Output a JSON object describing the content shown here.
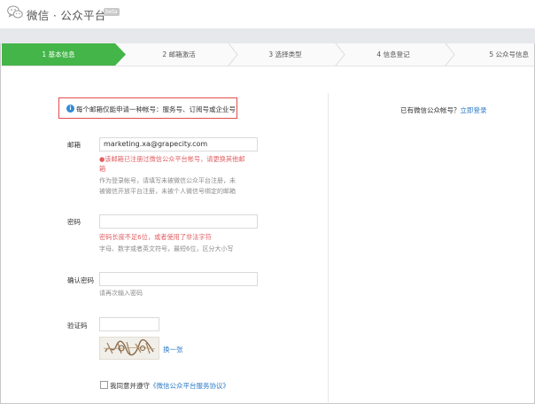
{
  "header": {
    "brand": "微信 · 公众平台",
    "badge": "beta"
  },
  "steps": [
    {
      "label": "1 基本信息",
      "active": true
    },
    {
      "label": "2 邮箱激活",
      "active": false
    },
    {
      "label": "3 选择类型",
      "active": false
    },
    {
      "label": "4 信息登记",
      "active": false
    },
    {
      "label": "5 公众号信息",
      "active": false
    }
  ],
  "notice": {
    "icon": "info-icon",
    "text": "每个邮箱仅能申请一种帐号：服务号、订阅号或企业号"
  },
  "form": {
    "email": {
      "label": "邮箱",
      "value": "marketing.xa@grapecity.com",
      "error_line1": "●该邮箱已注册过微信公众平台帐号，请更换其他邮",
      "error_line2": "箱",
      "tip_line1": "作为登录帐号，请填写未被微信公众平台注册，未",
      "tip_line2": "被微信开放平台注册，未被个人微信号绑定的邮箱"
    },
    "password": {
      "label": "密码",
      "value": "",
      "error": "密码长度不足6位，或者使用了非法字符",
      "tip": "字母、数字或者英文符号，最短6位，区分大小写"
    },
    "confirm_password": {
      "label": "确认密码",
      "value": "",
      "tip": "请再次输入密码"
    },
    "captcha": {
      "label": "验证码",
      "value": "",
      "refresh_label": "换一张"
    },
    "agreement": {
      "prefix": "我同意并遵守",
      "link": "《微信公众平台服务协议》",
      "checked": false
    }
  },
  "sidebar": {
    "prompt": "已有微信公众帐号？",
    "login_link": "立即登录"
  },
  "colors": {
    "accent": "#44b549",
    "error": "#e15f63",
    "link": "#2e7bc8",
    "notice_border": "#e44c4c"
  }
}
